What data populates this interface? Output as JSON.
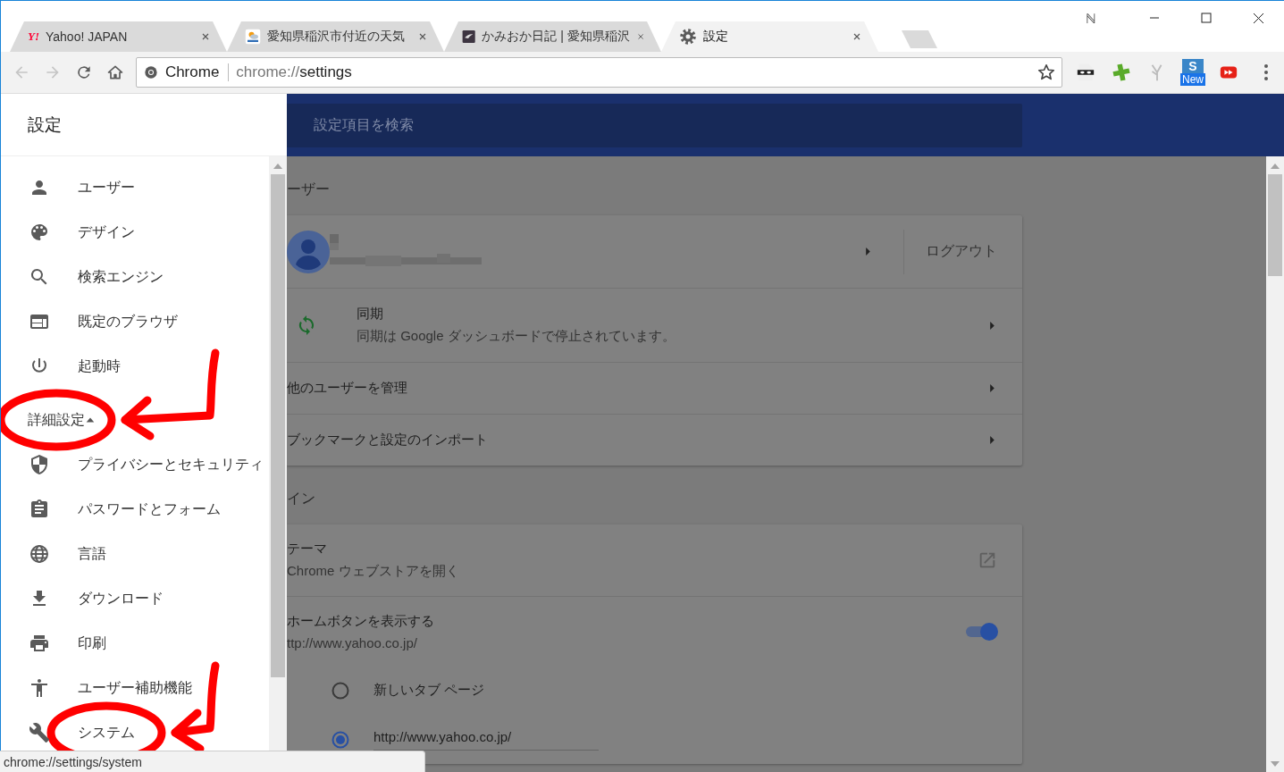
{
  "window": {
    "badge": "ℕ"
  },
  "tabs": [
    {
      "title": "Yahoo! JAPAN",
      "favicon_text": "Y!",
      "selected": false
    },
    {
      "title": "愛知県稲沢市付近の天気",
      "selected": false
    },
    {
      "title": "かみおか日記 | 愛知県稲沢",
      "selected": false
    },
    {
      "title": "設定",
      "selected": true
    }
  ],
  "toolbar": {
    "back": {
      "disabled": true
    },
    "forward": {
      "disabled": true
    },
    "omnibox": {
      "chip": "Chrome",
      "scheme": "chrome://",
      "path": "settings",
      "starred": false
    },
    "extensions": [
      {
        "kind": "mask"
      },
      {
        "kind": "plus"
      },
      {
        "kind": "sprout"
      },
      {
        "kind": "badge",
        "letter": "S",
        "badge": "New"
      },
      {
        "kind": "forward"
      }
    ]
  },
  "drawer": {
    "title": "設定",
    "items": [
      {
        "label": "ユーザー",
        "kind": "item",
        "annotated": false
      },
      {
        "label": "デザイン",
        "kind": "item",
        "annotated": false
      },
      {
        "label": "検索エンジン",
        "kind": "item",
        "annotated": false
      },
      {
        "label": "既定のブラウザ",
        "kind": "item",
        "annotated": false
      },
      {
        "label": "起動時",
        "kind": "item",
        "annotated": false
      },
      {
        "label": "詳細設定",
        "kind": "header",
        "expanded": true,
        "annotated": true
      },
      {
        "label": "プライバシーとセキュリティ",
        "kind": "item",
        "annotated": false
      },
      {
        "label": "パスワードとフォーム",
        "kind": "item",
        "annotated": false
      },
      {
        "label": "言語",
        "kind": "item",
        "annotated": false
      },
      {
        "label": "ダウンロード",
        "kind": "item",
        "annotated": false
      },
      {
        "label": "印刷",
        "kind": "item",
        "annotated": false
      },
      {
        "label": "ユーザー補助機能",
        "kind": "item",
        "annotated": false
      },
      {
        "label": "システム",
        "kind": "item",
        "annotated": true
      }
    ]
  },
  "header": {
    "search": {
      "placeholder": "設定項目を検索"
    }
  },
  "sections": [
    {
      "title": "ーザー",
      "rows": [
        {
          "kind": "account",
          "redacted": true,
          "action": "ログアウト"
        },
        {
          "kind": "sync",
          "title": "同期",
          "subtitle": "同期は Google ダッシュボードで停止されています。"
        },
        {
          "kind": "link",
          "title": "他のユーザーを管理"
        },
        {
          "kind": "link",
          "title": "ブックマークと設定のインポート"
        }
      ]
    },
    {
      "title": "イン",
      "rows": [
        {
          "kind": "external",
          "title": "テーマ",
          "subtitle": "Chrome ウェブストアを開く"
        },
        {
          "kind": "toggle",
          "title": "ホームボタンを表示する",
          "subtitle": "ttp://www.yahoo.co.jp/",
          "on": true
        },
        {
          "kind": "radio",
          "label": "新しいタブ ページ",
          "selected": false
        },
        {
          "kind": "radio",
          "label": "http://www.yahoo.co.jp/",
          "selected": true
        }
      ]
    }
  ],
  "status_bar": "chrome://settings/system"
}
